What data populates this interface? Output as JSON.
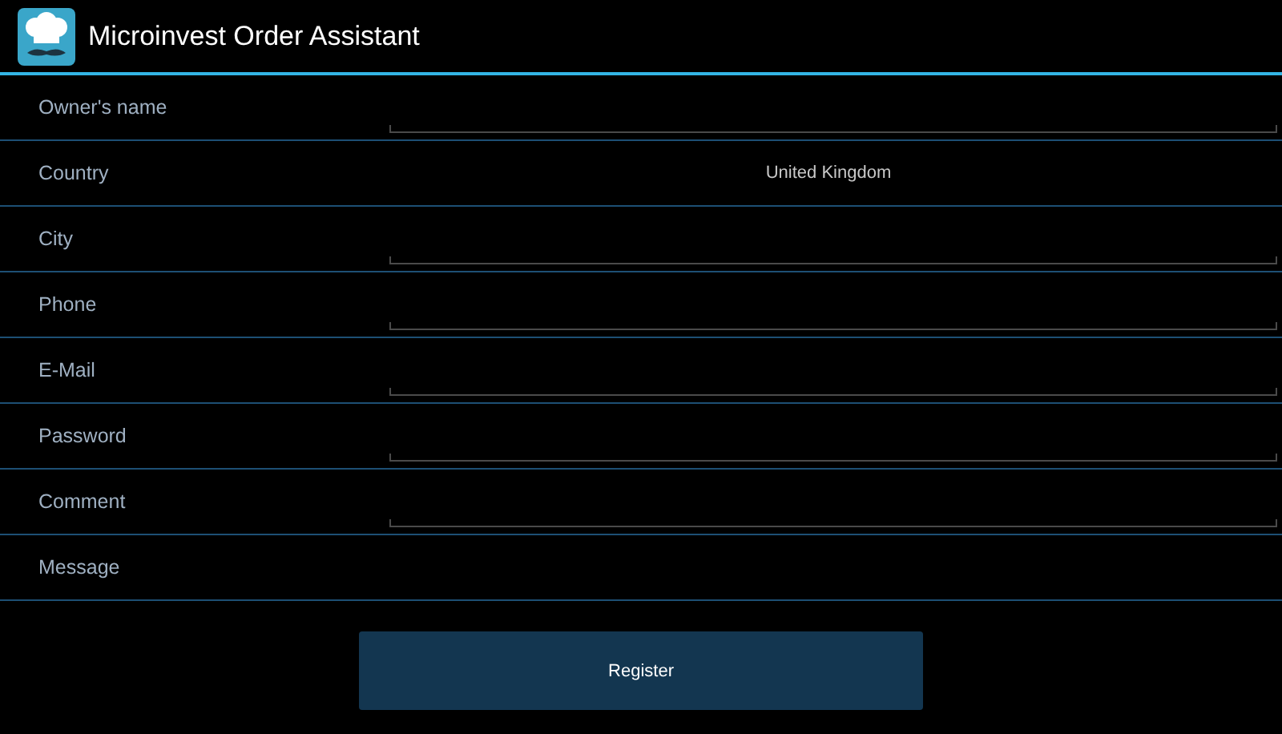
{
  "action_bar": {
    "title": "Microinvest Order Assistant"
  },
  "rows": [
    {
      "label": "Owner's name",
      "kind": "field"
    },
    {
      "label": "Country",
      "kind": "value",
      "value": "United Kingdom"
    },
    {
      "label": "City",
      "kind": "field"
    },
    {
      "label": "Phone",
      "kind": "field"
    },
    {
      "label": "E-Mail",
      "kind": "field"
    },
    {
      "label": "Password",
      "kind": "field"
    },
    {
      "label": "Comment",
      "kind": "field"
    },
    {
      "label": "Message",
      "kind": "none"
    }
  ],
  "button": {
    "label": "Register"
  }
}
